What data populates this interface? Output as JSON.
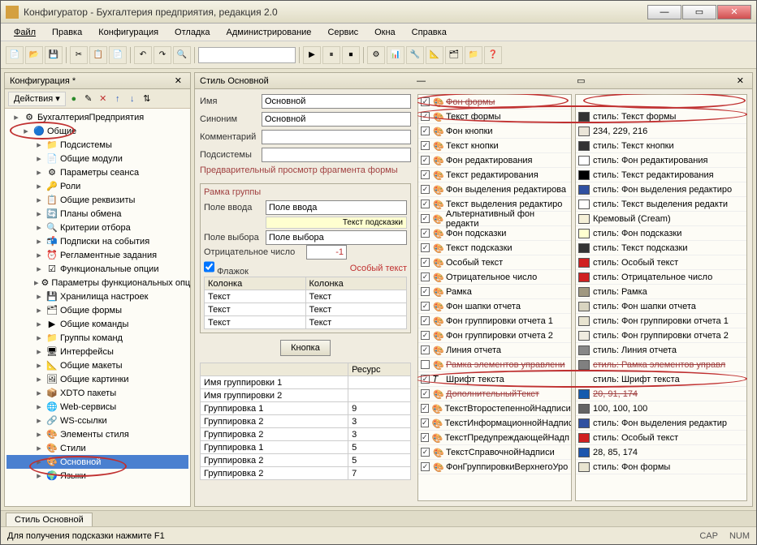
{
  "window": {
    "title": "Конфигуратор - Бухгалтерия предприятия, редакция 2.0"
  },
  "menu": {
    "file": "Файл",
    "edit": "Правка",
    "config": "Конфигурация",
    "debug": "Отладка",
    "admin": "Администрирование",
    "service": "Сервис",
    "windows": "Окна",
    "help": "Справка"
  },
  "left_panel": {
    "title": "Конфигурация *",
    "actions": "Действия",
    "root": "БухгалтерияПредприятия",
    "items": [
      {
        "label": "Общие",
        "lvl": 1,
        "icon": "🔵"
      },
      {
        "label": "Подсистемы",
        "lvl": 2,
        "icon": "📁"
      },
      {
        "label": "Общие модули",
        "lvl": 2,
        "icon": "📄"
      },
      {
        "label": "Параметры сеанса",
        "lvl": 2,
        "icon": "⚙"
      },
      {
        "label": "Роли",
        "lvl": 2,
        "icon": "🔑"
      },
      {
        "label": "Общие реквизиты",
        "lvl": 2,
        "icon": "📋"
      },
      {
        "label": "Планы обмена",
        "lvl": 2,
        "icon": "🔄"
      },
      {
        "label": "Критерии отбора",
        "lvl": 2,
        "icon": "🔍"
      },
      {
        "label": "Подписки на события",
        "lvl": 2,
        "icon": "📬"
      },
      {
        "label": "Регламентные задания",
        "lvl": 2,
        "icon": "⏰"
      },
      {
        "label": "Функциональные опции",
        "lvl": 2,
        "icon": "☑"
      },
      {
        "label": "Параметры функциональных опц",
        "lvl": 2,
        "icon": "⚙"
      },
      {
        "label": "Хранилища настроек",
        "lvl": 2,
        "icon": "💾"
      },
      {
        "label": "Общие формы",
        "lvl": 2,
        "icon": "🗂"
      },
      {
        "label": "Общие команды",
        "lvl": 2,
        "icon": "▶"
      },
      {
        "label": "Группы команд",
        "lvl": 2,
        "icon": "📁"
      },
      {
        "label": "Интерфейсы",
        "lvl": 2,
        "icon": "🖥"
      },
      {
        "label": "Общие макеты",
        "lvl": 2,
        "icon": "📐"
      },
      {
        "label": "Общие картинки",
        "lvl": 2,
        "icon": "🖼"
      },
      {
        "label": "XDTO пакеты",
        "lvl": 2,
        "icon": "📦"
      },
      {
        "label": "Web-сервисы",
        "lvl": 2,
        "icon": "🌐"
      },
      {
        "label": "WS-ссылки",
        "lvl": 2,
        "icon": "🔗"
      },
      {
        "label": "Элементы стиля",
        "lvl": 2,
        "icon": "🎨"
      },
      {
        "label": "Стили",
        "lvl": 2,
        "icon": "🎨"
      },
      {
        "label": "Основной",
        "lvl": 2,
        "icon": "🎨",
        "selected": true
      },
      {
        "label": "Языки",
        "lvl": 2,
        "icon": "🌍"
      }
    ]
  },
  "right_panel": {
    "title": "Стиль Основной",
    "form": {
      "name_label": "Имя",
      "name_value": "Основной",
      "syn_label": "Синоним",
      "syn_value": "Основной",
      "comment_label": "Комментарий",
      "comment_value": "",
      "subsys_label": "Подсистемы"
    },
    "preview_title": "Предварительный просмотр фрагмента формы",
    "group_title": "Рамка группы",
    "fields": {
      "input_label": "Поле ввода",
      "input_value": "Поле ввода",
      "tooltip": "Текст подсказки",
      "select_label": "Поле выбора",
      "select_value": "Поле выбора",
      "neg_label": "Отрицательное число",
      "neg_value": "-1",
      "flag_label": "Флажок",
      "special": "Особый текст"
    },
    "columns_table": {
      "head": [
        "Колонка",
        "Колонка"
      ],
      "rows": [
        [
          "Текст",
          "Текст"
        ],
        [
          "Текст",
          "Текст"
        ],
        [
          "Текст",
          "Текст"
        ]
      ]
    },
    "button_label": "Кнопка",
    "grouping_table": {
      "head": [
        "",
        "Ресурс"
      ],
      "rows": [
        [
          "Имя группировки 1",
          ""
        ],
        [
          "Имя группировки 2",
          ""
        ],
        [
          "Группировка 1",
          "9"
        ],
        [
          "Группировка 2",
          "3"
        ],
        [
          "Группировка 2",
          "3"
        ],
        [
          "Группировка 1",
          "5"
        ],
        [
          "Группировка 2",
          "5"
        ],
        [
          "Группировка 2",
          "7"
        ]
      ]
    }
  },
  "style_items": [
    {
      "name": "Фон формы",
      "chk": true,
      "crossed": true
    },
    {
      "name": "Текст формы",
      "chk": true,
      "val": "стиль: Текст формы",
      "sw": "#333333"
    },
    {
      "name": "Фон кнопки",
      "chk": true,
      "val": "234, 229, 216",
      "sw": "#eae5d8"
    },
    {
      "name": "Текст кнопки",
      "chk": true,
      "val": "стиль: Текст кнопки",
      "sw": "#333333"
    },
    {
      "name": "Фон редактирования",
      "chk": true,
      "val": "стиль: Фон редактирования",
      "sw": "#ffffff"
    },
    {
      "name": "Текст редактирования",
      "chk": true,
      "val": "стиль: Текст редактирования",
      "sw": "#000000"
    },
    {
      "name": "Фон выделения редактирова",
      "chk": true,
      "val": "стиль: Фон выделения редактиро",
      "sw": "#3050a0"
    },
    {
      "name": "Текст выделения редактиро",
      "chk": true,
      "val": "стиль: Текст выделения редакти",
      "sw": "#ffffff"
    },
    {
      "name": "Альтернативный фон редакти",
      "chk": true,
      "val": "Кремовый (Cream)",
      "sw": "#f5f0d8"
    },
    {
      "name": "Фон подсказки",
      "chk": true,
      "val": "стиль: Фон подсказки",
      "sw": "#ffffd0"
    },
    {
      "name": "Текст подсказки",
      "chk": true,
      "val": "стиль: Текст подсказки",
      "sw": "#333333"
    },
    {
      "name": "Особый текст",
      "chk": true,
      "val": "стиль: Особый текст",
      "sw": "#d02020"
    },
    {
      "name": "Отрицательное число",
      "chk": true,
      "val": "стиль: Отрицательное число",
      "sw": "#d02020"
    },
    {
      "name": "Рамка",
      "chk": true,
      "val": "стиль: Рамка",
      "sw": "#a09880"
    },
    {
      "name": "Фон шапки отчета",
      "chk": true,
      "val": "стиль: Фон шапки отчета",
      "sw": "#d8d4c0"
    },
    {
      "name": "Фон группировки отчета 1",
      "chk": true,
      "val": "стиль: Фон группировки отчета 1",
      "sw": "#e8e4d0"
    },
    {
      "name": "Фон группировки отчета 2",
      "chk": true,
      "val": "стиль: Фон группировки отчета 2",
      "sw": "#f0ece0"
    },
    {
      "name": "Линия отчета",
      "chk": true,
      "val": "стиль: Линия отчета",
      "sw": "#888888"
    },
    {
      "name": "Рамка элементов управлени",
      "chk": false,
      "val": "стиль: Рамка элементов управл",
      "sw": "#808080",
      "crossed": true
    },
    {
      "name": "Шрифт текста",
      "chk": true,
      "val": "стиль: Шрифт текста",
      "sw": "",
      "font": true
    },
    {
      "name": "ДополнительныйТекст",
      "chk": true,
      "val": "20, 91, 174",
      "sw": "#145bae",
      "crossed": true
    },
    {
      "name": "ТекстВторостепеннойНадписи",
      "chk": true,
      "val": "100, 100, 100",
      "sw": "#646464"
    },
    {
      "name": "ТекстИнформационнойНадпис",
      "chk": true,
      "val": "стиль: Фон выделения редактир",
      "sw": "#3050a0"
    },
    {
      "name": "ТекстПредупреждающейНадп",
      "chk": true,
      "val": "стиль: Особый текст",
      "sw": "#d02020"
    },
    {
      "name": "ТекстСправочнойНадписи",
      "chk": true,
      "val": "28, 85, 174",
      "sw": "#1c55ae"
    },
    {
      "name": "ФонГруппировкиВерхнегоУро",
      "chk": true,
      "val": "стиль: Фон формы",
      "sw": "#e8e4d0"
    }
  ],
  "bottom_tab": "Стиль Основной",
  "statusbar": {
    "help": "Для получения подсказки нажмите F1",
    "cap": "CAP",
    "num": "NUM"
  }
}
